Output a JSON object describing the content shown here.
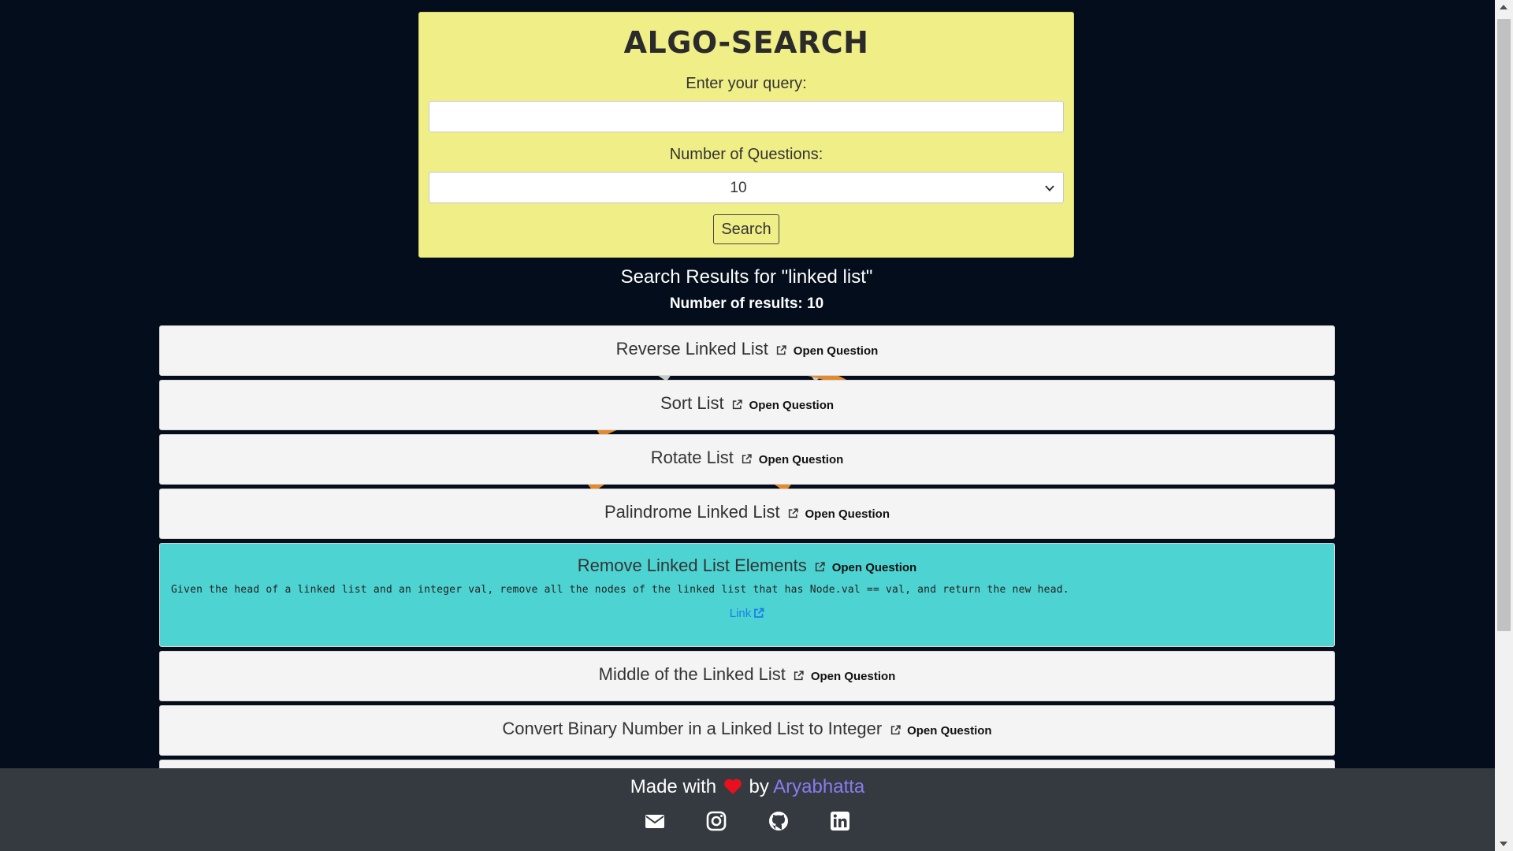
{
  "header": {
    "title": "ALGO-SEARCH"
  },
  "form": {
    "query_label": "Enter your query:",
    "query_value": "",
    "num_label": "Number of Questions:",
    "num_selected": "10",
    "search_label": "Search"
  },
  "results": {
    "title": "Search Results for \"linked list\"",
    "count_label": "Number of results: 10",
    "open_label": "Open Question",
    "items": [
      {
        "title": "Reverse Linked List"
      },
      {
        "title": "Sort List"
      },
      {
        "title": "Rotate List"
      },
      {
        "title": "Palindrome Linked List"
      },
      {
        "title": "Remove Linked List Elements",
        "description": "Given the head of a linked list and an integer val, remove all the nodes of the linked list that has Node.val == val, and return the new head.",
        "link_label": "Link"
      },
      {
        "title": "Middle of the Linked List"
      },
      {
        "title": "Convert Binary Number in a Linked List to Integer"
      }
    ]
  },
  "footer": {
    "made_with": "Made with",
    "by": "by",
    "author": "Aryabhatta",
    "icons": [
      "mail-icon",
      "instagram-icon",
      "github-icon",
      "linkedin-icon"
    ]
  },
  "colors": {
    "background": "#040d1b",
    "card": "#f0ee87",
    "active_result": "#4dd4d2",
    "footer": "#343a40",
    "author_link": "#8a7bf0",
    "heart": "#e8101e"
  }
}
